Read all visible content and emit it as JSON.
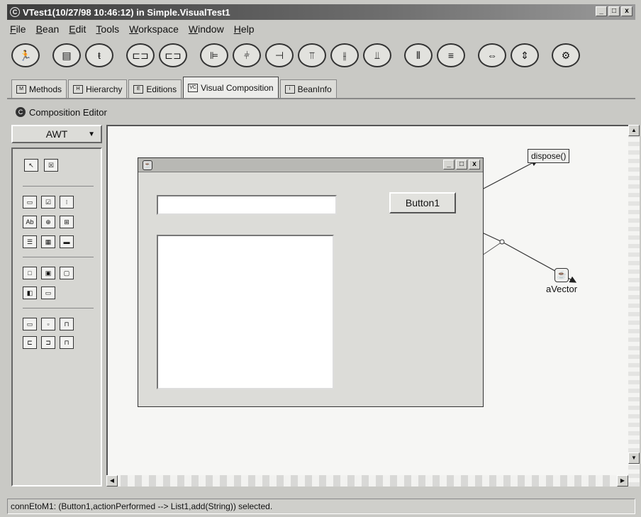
{
  "window": {
    "title": "VTest1(10/27/98 10:46:12) in Simple.VisualTest1",
    "minimize": "_",
    "maximize": "□",
    "close": "x"
  },
  "menu": [
    "File",
    "Bean",
    "Edit",
    "Tools",
    "Workspace",
    "Window",
    "Help"
  ],
  "toolbar": {
    "icons": [
      "run-icon",
      "list-icon",
      "hierarchy-icon",
      "link-icon",
      "link2-icon",
      "align-left-icon",
      "align-center-icon",
      "align-right-icon",
      "align-top-icon",
      "align-middle-icon",
      "align-bottom-icon",
      "distribute-horizontal-icon",
      "distribute-vertical-icon",
      "match-width-icon",
      "match-height-icon",
      "settings-icon"
    ]
  },
  "tabs": [
    {
      "label": "Methods",
      "icon": "methods-icon",
      "active": false
    },
    {
      "label": "Hierarchy",
      "icon": "hierarchy-icon",
      "active": false
    },
    {
      "label": "Editions",
      "icon": "editions-icon",
      "active": false
    },
    {
      "label": "Visual Composition",
      "icon": "visual-composition-icon",
      "active": true
    },
    {
      "label": "BeanInfo",
      "icon": "beaninfo-icon",
      "active": false
    }
  ],
  "composition_editor": {
    "label": "Composition Editor",
    "palette_category": "AWT"
  },
  "canvas": {
    "button_label": "Button1",
    "dispose_label": "dispose()",
    "vector_label": "aVector"
  },
  "status": {
    "text": "connEtoM1:  (Button1,actionPerformed --> List1,add(String)) selected."
  }
}
